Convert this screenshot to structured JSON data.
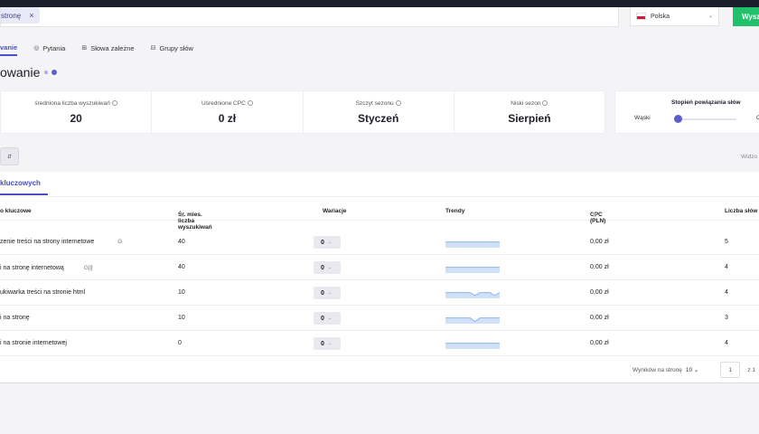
{
  "search": {
    "chip_text": "stronę",
    "chip_close": "×"
  },
  "country": {
    "name": "Polska",
    "chevron": "⌄"
  },
  "search_button": {
    "label": "Wysz"
  },
  "tabs": [
    {
      "label": "vanie",
      "icon": "",
      "active": true
    },
    {
      "label": "Pytania",
      "icon": "◎",
      "active": false
    },
    {
      "label": "Słowa zależne",
      "icon": "⊞",
      "active": false
    },
    {
      "label": "Grupy słów",
      "icon": "⊟",
      "active": false
    }
  ],
  "page_title": {
    "text": "owanie",
    "sup": "≋"
  },
  "stats": [
    {
      "label": "średniona liczba wyszukiwań",
      "value": "20"
    },
    {
      "label": "Uśrednione CPC",
      "value": "0 zł"
    },
    {
      "label": "Szczyt sezonu",
      "value": "Styczeń"
    },
    {
      "label": "Niski sezon",
      "value": "Sierpień"
    }
  ],
  "relatedness": {
    "title": "Stopień powiązania słów",
    "left": "Wąski",
    "right": "O",
    "level": 0.0
  },
  "filter_button": {
    "label": "⇵"
  },
  "view_label": "Widzo",
  "table": {
    "tab_label": "kluczowych",
    "headers": {
      "keyword": "o kluczowe",
      "volume": "Śr. mies. liczba wyszukiwań",
      "variations": "Wariacje",
      "trends": "Trendy",
      "cpc": "CPC (PLN)",
      "count": "Liczba słów"
    },
    "sort_glyph": "⇅",
    "rows": [
      {
        "keyword": "zenie treści na strony internetowe",
        "glyph": "G",
        "volume": "40",
        "variations": "0",
        "cpc": "0,00 zł",
        "count": "5",
        "trend": [
          0.8,
          0.8,
          0.8,
          0.8,
          0.8,
          0.8,
          0.8,
          0.8,
          0.8,
          0.8,
          0.8,
          0.8
        ]
      },
      {
        "keyword": "i na stronę internetową",
        "glyph": "G|∥",
        "volume": "40",
        "variations": "0",
        "cpc": "0,00 zł",
        "count": "4",
        "trend": [
          0.8,
          0.8,
          0.8,
          0.8,
          0.8,
          0.8,
          0.8,
          0.8,
          0.8,
          0.8,
          0.8,
          0.8
        ]
      },
      {
        "keyword": "ukiwarka treści na stronie html",
        "glyph": "",
        "volume": "10",
        "variations": "0",
        "cpc": "0,00 zł",
        "count": "4",
        "trend": [
          0.8,
          0.8,
          0.8,
          0.8,
          0.8,
          0.8,
          0.4,
          0.8,
          0.8,
          0.8,
          0.4,
          0.8
        ]
      },
      {
        "keyword": "i na stronę",
        "glyph": "",
        "volume": "10",
        "variations": "0",
        "cpc": "0,00 zł",
        "count": "3",
        "trend": [
          0.8,
          0.8,
          0.8,
          0.8,
          0.8,
          0.8,
          0.3,
          0.8,
          0.8,
          0.8,
          0.8,
          0.8
        ]
      },
      {
        "keyword": "i na stronie internetowej",
        "glyph": "",
        "volume": "0",
        "variations": "0",
        "cpc": "0,00 zł",
        "count": "4",
        "trend": [
          0.8,
          0.8,
          0.8,
          0.8,
          0.8,
          0.8,
          0.8,
          0.8,
          0.8,
          0.8,
          0.8,
          0.8
        ]
      }
    ]
  },
  "pager": {
    "per_page_label": "Wyników na stronę",
    "per_page": "10",
    "dropdown": "⌄",
    "page": "1",
    "of": "z 1"
  }
}
